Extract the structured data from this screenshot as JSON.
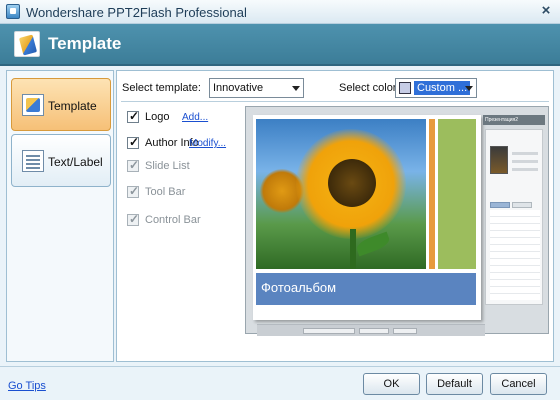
{
  "window": {
    "title": "Wondershare PPT2Flash Professional",
    "close_glyph": "×"
  },
  "header": {
    "title": "Template"
  },
  "sidebar": {
    "items": [
      {
        "label": "Template",
        "icon": "template-icon",
        "active": true
      },
      {
        "label": "Text/Label",
        "icon": "text-label-icon",
        "active": false
      }
    ]
  },
  "selectors": {
    "template_label": "Select template:",
    "template_value": "Innovative",
    "color_label": "Select color:",
    "color_value": "Custom ..."
  },
  "options": [
    {
      "label": "Logo",
      "checked": true,
      "enabled": true,
      "link": "Add..."
    },
    {
      "label": "Author Info",
      "checked": true,
      "enabled": true,
      "link": "Modify..."
    },
    {
      "label": "Slide List",
      "checked": true,
      "enabled": false
    },
    {
      "label": "Tool Bar",
      "checked": true,
      "enabled": false
    },
    {
      "label": "Control Bar",
      "checked": true,
      "enabled": false
    }
  ],
  "preview": {
    "caption": "Фотоальбом",
    "thumb_header": "Презентация2",
    "colors": {
      "orange_bar": "#e79a3d",
      "green_panel": "#9cbd5d",
      "caption_bar": "#5a84c0"
    }
  },
  "footer": {
    "tips_link": "Go Tips",
    "ok": "OK",
    "default": "Default",
    "cancel": "Cancel"
  }
}
